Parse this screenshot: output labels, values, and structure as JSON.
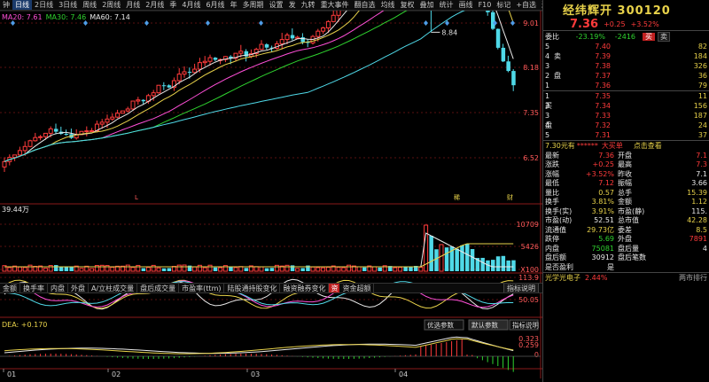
{
  "toolbar": {
    "left_items": [
      "钟",
      "日线",
      "2日线",
      "3日线",
      "周线",
      "2周线",
      "月线",
      "2月线",
      "季",
      "4月线",
      "6月线",
      "年",
      "多周期",
      "设置"
    ],
    "active_index": 1,
    "right_items": [
      "发",
      "九转",
      "重大事件",
      "翻自选",
      "均线",
      "复权",
      "叠加",
      "统计",
      "画线",
      "F10",
      "标记",
      "+自选",
      "返回"
    ]
  },
  "ma": [
    {
      "label": "MA20: 7.61",
      "color": "#ff4fd8"
    },
    {
      "label": "MA30: 7.46",
      "color": "#2fd32f"
    },
    {
      "label": "MA60: 7.14",
      "color": "#e8e8e8"
    }
  ],
  "price_axis": [
    "9.01",
    "8.18",
    "7.35",
    "6.52"
  ],
  "high_label": "8.84",
  "event_markers": [
    "L",
    "稀",
    "财"
  ],
  "vol_label": "39.44万",
  "vol_axis": [
    "10709",
    "5426",
    "X100"
  ],
  "ind_tabs": [
    "金额",
    "换手率",
    "内盘",
    "外盘",
    "A/立柱成交量",
    "盘后成交量",
    "市盈率(ttm)",
    "陆股通持股变化",
    "融资融券变化"
  ],
  "ind_badge": "资",
  "ind_tab_last": "资金超额",
  "ind_help": "指标说明",
  "osc_axis": [
    "113.9",
    "50.05"
  ],
  "macd_label": "DEA: +0.170",
  "macd_buttons": [
    "优选参数",
    "默认参数",
    "指标说明"
  ],
  "macd_axis": [
    "0.323",
    "0.259",
    "0"
  ],
  "date_axis": [
    "01",
    "02",
    "03",
    "04"
  ],
  "colors": {
    "up": "#ff3b3b",
    "down": "#4fd9e8",
    "accent": "#e8d24a"
  },
  "panel": {
    "title": "经纬辉开 300120",
    "price": "7.36",
    "change": "+0.25",
    "pct": "+3.52%",
    "weibi_label": "委比",
    "weibi": "-23.19%",
    "weicha": "-2416",
    "buy_btn": "买",
    "sell_btn": "卖",
    "sell_side_label": [
      "卖",
      "盘"
    ],
    "buy_side_label": [
      "买",
      "盘"
    ],
    "asks": [
      {
        "lvl": "5",
        "price": "7.40",
        "vol": "82"
      },
      {
        "lvl": "4",
        "price": "7.39",
        "vol": "184"
      },
      {
        "lvl": "3",
        "price": "7.38",
        "vol": "326"
      },
      {
        "lvl": "2",
        "price": "7.37",
        "vol": "36"
      },
      {
        "lvl": "1",
        "price": "7.36",
        "vol": "79"
      }
    ],
    "bids": [
      {
        "lvl": "1",
        "price": "7.35",
        "vol": "11"
      },
      {
        "lvl": "2",
        "price": "7.34",
        "vol": "156"
      },
      {
        "lvl": "3",
        "price": "7.33",
        "vol": "187"
      },
      {
        "lvl": "4",
        "price": "7.32",
        "vol": "24"
      },
      {
        "lvl": "5",
        "price": "7.31",
        "vol": "37"
      }
    ],
    "trade_bar": {
      "left": "7.30元有",
      "stars": "******",
      "mid": "大买单",
      "right": "点击查看"
    },
    "stats": [
      {
        "k1": "最新",
        "v1": "7.36",
        "c1": "c-red",
        "k2": "开盘",
        "v2": "7.1",
        "c2": "c-red"
      },
      {
        "k1": "涨跌",
        "v1": "+0.25",
        "c1": "c-red",
        "k2": "最高",
        "v2": "7.3",
        "c2": "c-red"
      },
      {
        "k1": "涨幅",
        "v1": "+3.52%",
        "c1": "c-red",
        "k2": "昨收",
        "v2": "7.1",
        "c2": "c-white"
      },
      {
        "k1": "最低",
        "v1": "7.12",
        "c1": "c-red",
        "k2": "振幅",
        "v2": "3.66",
        "c2": "c-white"
      },
      {
        "k1": "量比",
        "v1": "0.57",
        "c1": "c-yellow",
        "k2": "总手",
        "v2": "15.39",
        "c2": "c-yellow"
      },
      {
        "k1": "换手",
        "v1": "3.81%",
        "c1": "c-yellow",
        "k2": "金额",
        "v2": "1.12",
        "c2": "c-yellow"
      },
      {
        "k1": "换手(实)",
        "v1": "3.91%",
        "c1": "c-yellow",
        "k2": "市盈(静)",
        "v2": "115.",
        "c2": "c-white"
      },
      {
        "k1": "市盈(动)",
        "v1": "52.51",
        "c1": "c-white",
        "k2": "总市值",
        "v2": "42.28",
        "c2": "c-yellow"
      },
      {
        "k1": "流通值",
        "v1": "29.73亿",
        "c1": "c-yellow",
        "k2": "委差",
        "v2": "8.5",
        "c2": "c-yellow"
      },
      {
        "k1": "跌停",
        "v1": "5.69",
        "c1": "c-green",
        "k2": "外盘",
        "v2": "7891",
        "c2": "c-red"
      },
      {
        "k1": "内盘",
        "v1": "75081",
        "c1": "c-green",
        "k2": "盘后量",
        "v2": "4",
        "c2": "c-white"
      },
      {
        "k1": "盘后额",
        "v1": "30912",
        "c1": "c-white",
        "k2": "盘后笔数",
        "v2": "",
        "c2": "c-white"
      },
      {
        "k1": "是否盈利",
        "v1": "是",
        "c1": "c-white",
        "k2": "",
        "v2": "",
        "c2": "c-white"
      }
    ],
    "sector": {
      "name": "光学光电子",
      "pct": "2.44%",
      "right": "两市排行"
    }
  }
}
